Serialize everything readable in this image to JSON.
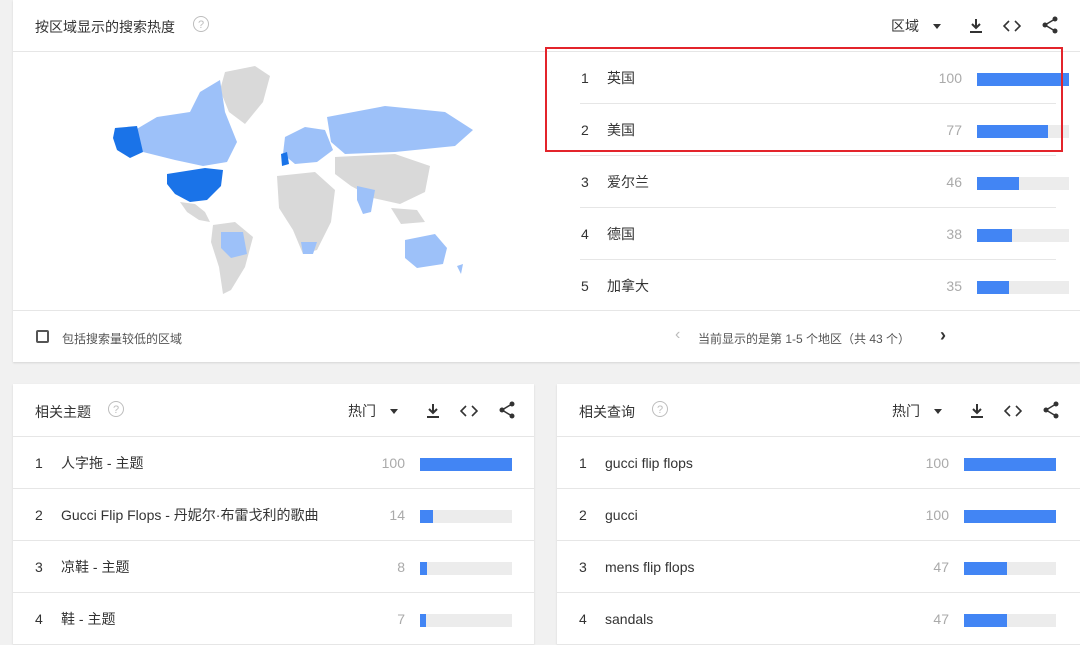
{
  "region": {
    "title": "按区域显示的搜索热度",
    "help": "?",
    "dropdown_label": "区域",
    "rows": [
      {
        "rank": "1",
        "name": "英国",
        "value": "100",
        "pct": 100
      },
      {
        "rank": "2",
        "name": "美国",
        "value": "77",
        "pct": 77
      },
      {
        "rank": "3",
        "name": "爱尔兰",
        "value": "46",
        "pct": 46
      },
      {
        "rank": "4",
        "name": "德国",
        "value": "38",
        "pct": 38
      },
      {
        "rank": "5",
        "name": "加拿大",
        "value": "35",
        "pct": 35
      }
    ],
    "checkbox_label": "包括搜索量较低的区域",
    "pagination": "当前显示的是第 1-5 个地区（共 43 个）",
    "prev": "‹",
    "next": "›"
  },
  "topics": {
    "title": "相关主题",
    "help": "?",
    "dropdown_label": "热门",
    "rows": [
      {
        "rank": "1",
        "name": "人字拖 - 主题",
        "value": "100",
        "pct": 100
      },
      {
        "rank": "2",
        "name": "Gucci Flip Flops - 丹妮尔·布雷戈利的歌曲",
        "value": "14",
        "pct": 14
      },
      {
        "rank": "3",
        "name": "凉鞋 - 主题",
        "value": "8",
        "pct": 8
      },
      {
        "rank": "4",
        "name": "鞋 - 主题",
        "value": "7",
        "pct": 7
      }
    ]
  },
  "queries": {
    "title": "相关查询",
    "help": "?",
    "dropdown_label": "热门",
    "rows": [
      {
        "rank": "1",
        "name": "gucci flip flops",
        "value": "100",
        "pct": 100
      },
      {
        "rank": "2",
        "name": "gucci",
        "value": "100",
        "pct": 100
      },
      {
        "rank": "3",
        "name": "mens flip flops",
        "value": "47",
        "pct": 47
      },
      {
        "rank": "4",
        "name": "sandals",
        "value": "47",
        "pct": 47
      }
    ]
  },
  "icons": {
    "download": "download-icon",
    "embed": "embed-icon",
    "share": "share-icon",
    "caret": "caret-down-icon",
    "help": "help-icon"
  },
  "colors": {
    "bar": "#4285f4",
    "track": "#ececec",
    "highlight": "#e3242b",
    "map_max": "#1a73e8",
    "map_high": "#5e97f6",
    "map_mid": "#9dc1f9",
    "map_none": "#d9d9d9"
  }
}
